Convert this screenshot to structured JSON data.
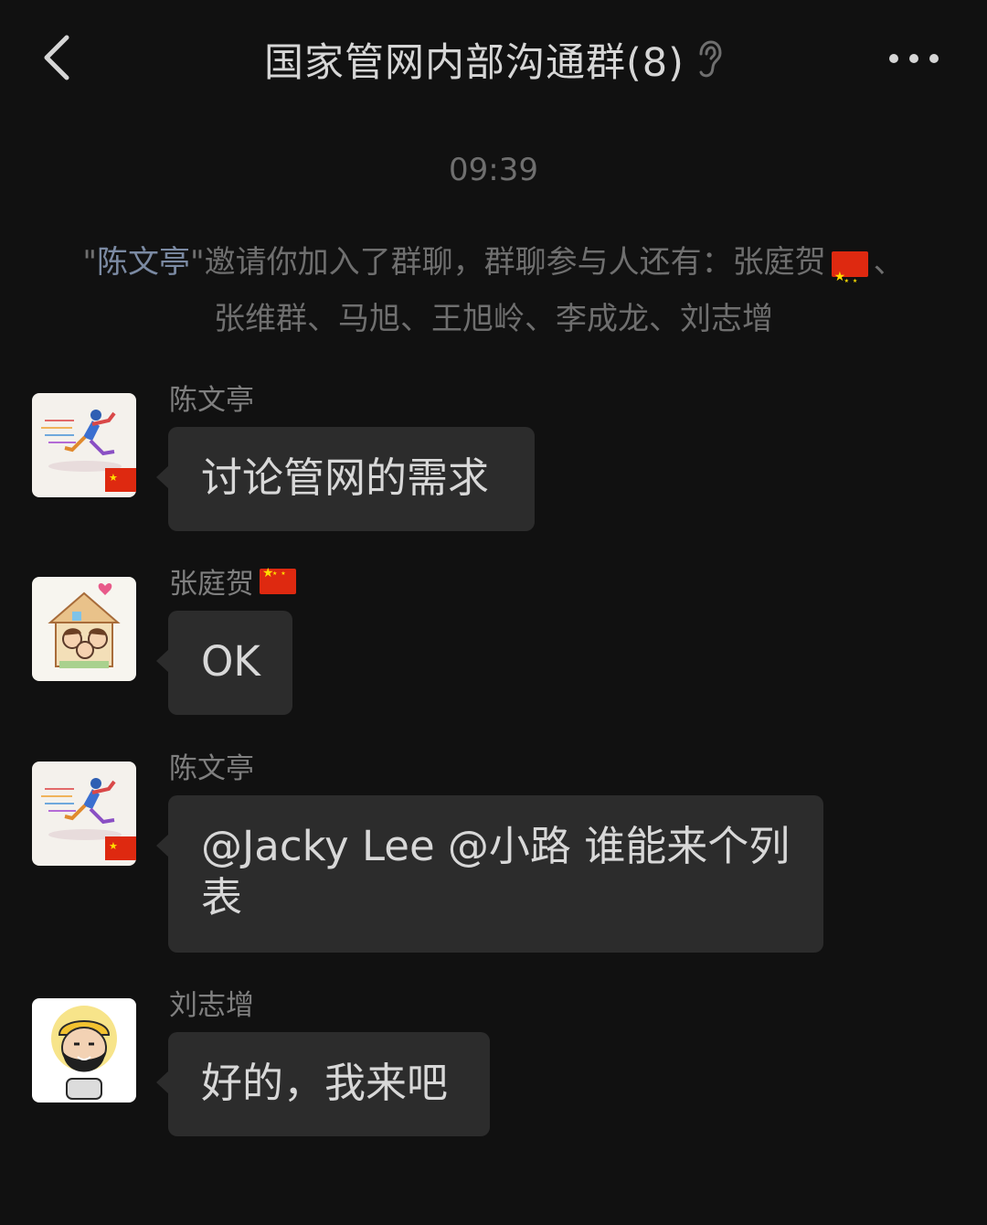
{
  "header": {
    "title": "国家管网内部沟通群(8)",
    "back_icon": "chevron-left-icon",
    "mute_icon": "ear-icon",
    "more_icon": "more-dots-icon"
  },
  "time": "09:39",
  "notice": {
    "quote_open": "\"",
    "inviter": "陈文亭",
    "quote_close": "\"",
    "text_before": "邀请你加入了群聊，群聊参与人还有：张庭贺",
    "text_after": "、张维群、马旭、王旭岭、李成龙、刘志增"
  },
  "messages": [
    {
      "sender": "陈文亭",
      "text": "讨论管网的需求"
    },
    {
      "sender": "张庭贺",
      "text": "OK"
    },
    {
      "sender": "陈文亭",
      "text": "@Jacky Lee @小路 谁能来个列表"
    },
    {
      "sender": "刘志增",
      "text": "好的，我来吧"
    }
  ],
  "colors": {
    "background": "#111111",
    "bubble": "#2c2c2c",
    "text": "#d8d8d8",
    "muted": "#6f6f6f",
    "highlight": "#7b8aa3"
  }
}
